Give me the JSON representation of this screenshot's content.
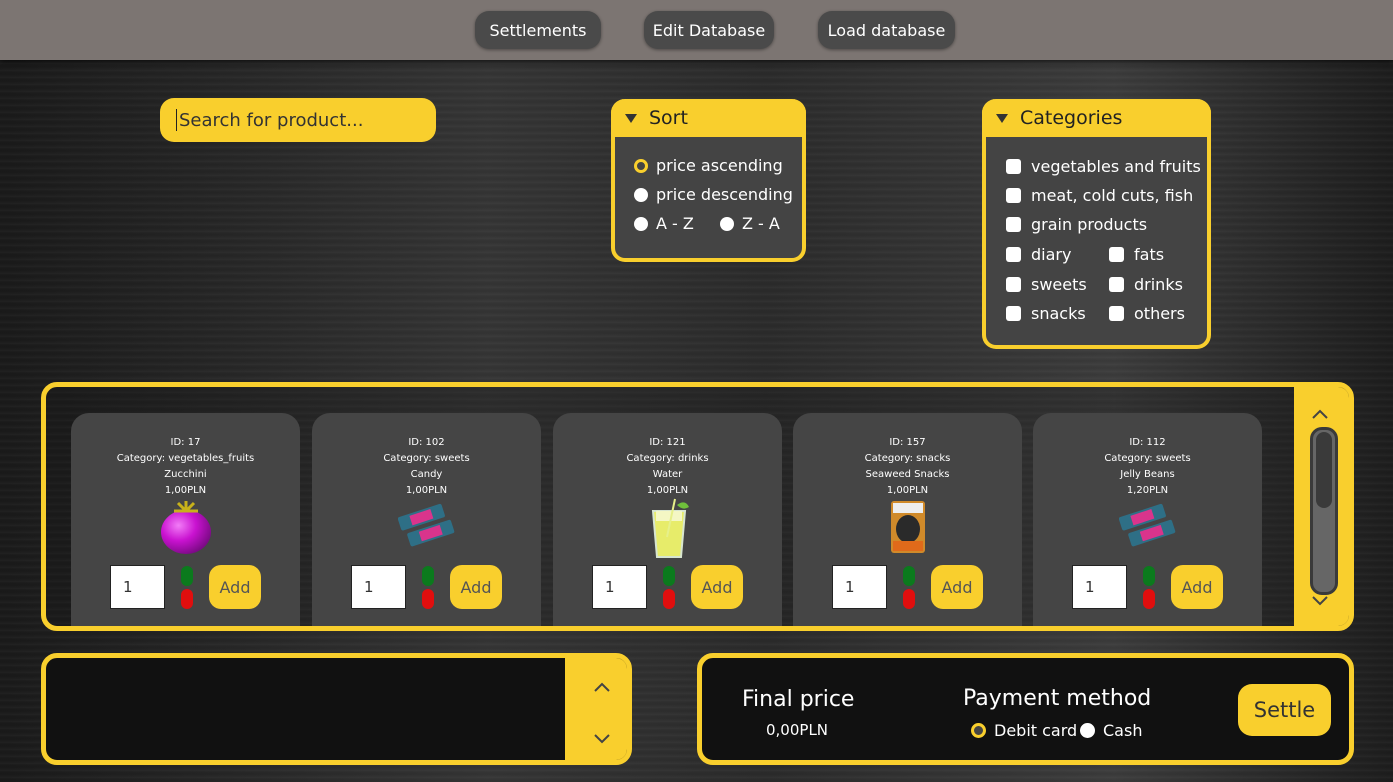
{
  "toolbar": {
    "settlements_label": "Settlements",
    "edit_database_label": "Edit Database",
    "load_database_label": "Load database"
  },
  "search": {
    "placeholder": "Search for product..."
  },
  "sort": {
    "title": "Sort",
    "options": [
      "price ascending",
      "price descending",
      "A - Z",
      "Z - A"
    ],
    "selected": "price ascending"
  },
  "categories": {
    "title": "Categories",
    "items": [
      "vegetables and fruits",
      "meat, cold cuts, fish",
      "grain products",
      "diary",
      "fats",
      "sweets",
      "drinks",
      "snacks",
      "others"
    ]
  },
  "products": [
    {
      "id_text": "ID: 17",
      "category_text": "Category: vegetables_fruits",
      "name": "Zucchini",
      "price": "1,00PLN",
      "quantity": "1",
      "add_label": "Add",
      "icon": "purple-vegetable-icon"
    },
    {
      "id_text": "ID: 102",
      "category_text": "Category: sweets",
      "name": "Candy",
      "price": "1,00PLN",
      "quantity": "1",
      "add_label": "Add",
      "icon": "candy-bar-icon"
    },
    {
      "id_text": "ID: 121",
      "category_text": "Category: drinks",
      "name": "Water",
      "price": "1,00PLN",
      "quantity": "1",
      "add_label": "Add",
      "icon": "drink-glass-icon"
    },
    {
      "id_text": "ID: 157",
      "category_text": "Category: snacks",
      "name": "Seaweed Snacks",
      "price": "1,00PLN",
      "quantity": "1",
      "add_label": "Add",
      "icon": "chips-bag-icon"
    },
    {
      "id_text": "ID: 112",
      "category_text": "Category: sweets",
      "name": "Jelly Beans",
      "price": "1,20PLN",
      "quantity": "1",
      "add_label": "Add",
      "icon": "candy-bar-icon"
    }
  ],
  "summary": {
    "final_price_label": "Final price",
    "final_price_value": "0,00PLN",
    "payment_method_label": "Payment method",
    "payment_options": [
      "Debit card",
      "Cash"
    ],
    "payment_selected": "Debit card",
    "settle_label": "Settle"
  },
  "colors": {
    "accent": "#f9cf2d",
    "panel": "#444444",
    "topbar": "#7c7572"
  }
}
